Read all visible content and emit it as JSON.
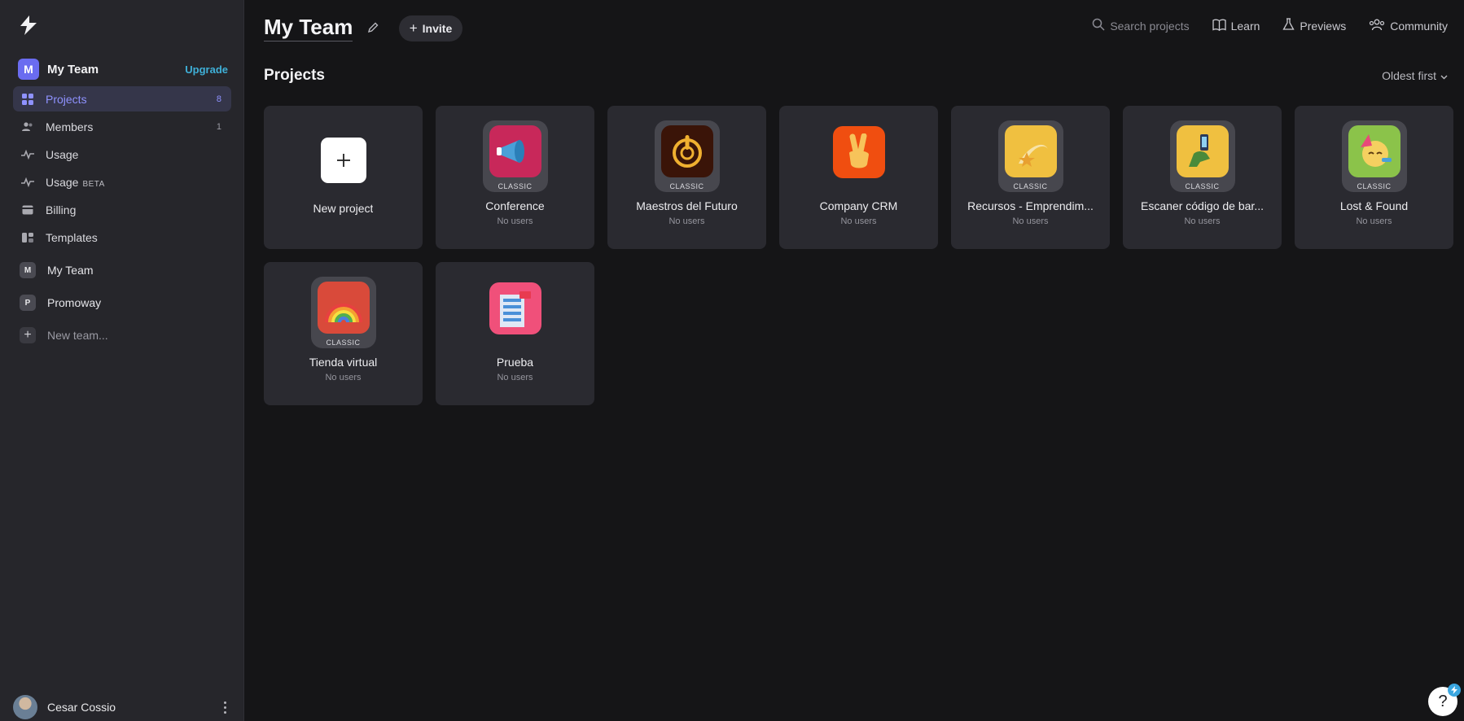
{
  "sidebar": {
    "team": {
      "initial": "M",
      "name": "My Team",
      "upgrade": "Upgrade"
    },
    "nav": [
      {
        "label": "Projects",
        "count": "8"
      },
      {
        "label": "Members",
        "count": "1"
      },
      {
        "label": "Usage"
      },
      {
        "label": "Usage",
        "badge": "BETA"
      },
      {
        "label": "Billing"
      },
      {
        "label": "Templates"
      }
    ],
    "teams": [
      {
        "initial": "M",
        "name": "My Team"
      },
      {
        "initial": "P",
        "name": "Promoway"
      }
    ],
    "new_team": "New team...",
    "user": {
      "name": "Cesar Cossio"
    }
  },
  "header": {
    "title": "My Team",
    "invite": "Invite",
    "search_placeholder": "Search projects",
    "links": {
      "learn": "Learn",
      "previews": "Previews",
      "community": "Community"
    }
  },
  "projects": {
    "title": "Projects",
    "sort": "Oldest first",
    "new_project": "New project",
    "classic_label": "CLASSIC",
    "items": [
      {
        "name": "Conference",
        "users": "No users",
        "classic": true,
        "color": "#c8285a",
        "icon": "megaphone-icon"
      },
      {
        "name": "Maestros del Futuro",
        "users": "No users",
        "classic": true,
        "color": "#3a1408",
        "icon": "power-dial-icon"
      },
      {
        "name": "Company CRM",
        "users": "No users",
        "classic": false,
        "color": "#f04e10",
        "icon": "victory-hand-icon"
      },
      {
        "name": "Recursos - Emprendim...",
        "users": "No users",
        "classic": true,
        "color": "#f0c040",
        "icon": "shooting-star-icon"
      },
      {
        "name": "Escaner código de bar...",
        "users": "No users",
        "classic": true,
        "color": "#f0c040",
        "icon": "hand-phone-icon"
      },
      {
        "name": "Lost & Found",
        "users": "No users",
        "classic": true,
        "color": "#8bc34a",
        "icon": "party-face-icon"
      },
      {
        "name": "Tienda virtual",
        "users": "No users",
        "classic": true,
        "color": "#d94a3a",
        "icon": "rainbow-icon"
      },
      {
        "name": "Prueba",
        "users": "No users",
        "classic": false,
        "color": "#f0507a",
        "icon": "building-icon"
      }
    ]
  },
  "help": {
    "label": "?"
  }
}
